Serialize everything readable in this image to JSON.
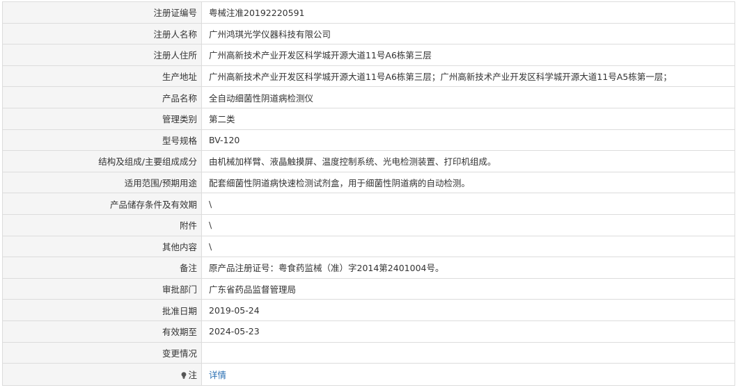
{
  "rows": [
    {
      "label": "注册证编号",
      "value": "粤械注准20192220591"
    },
    {
      "label": "注册人名称",
      "value": "广州鸿琪光学仪器科技有限公司"
    },
    {
      "label": "注册人住所",
      "value": "广州高新技术产业开发区科学城开源大道11号A6栋第三层"
    },
    {
      "label": "生产地址",
      "value": "广州高新技术产业开发区科学城开源大道11号A6栋第三层；广州高新技术产业开发区科学城开源大道11号A5栋第一层；"
    },
    {
      "label": "产品名称",
      "value": "全自动细菌性阴道病检测仪"
    },
    {
      "label": "管理类别",
      "value": "第二类"
    },
    {
      "label": "型号规格",
      "value": "BV-120"
    },
    {
      "label": "结构及组成/主要组成成分",
      "value": "由机械加样臂、液晶触摸屏、温度控制系统、光电检测装置、打印机组成。"
    },
    {
      "label": "适用范围/预期用途",
      "value": "配套细菌性阴道病快速检测试剂盒，用于细菌性阴道病的自动检测。"
    },
    {
      "label": "产品储存条件及有效期",
      "value": "\\"
    },
    {
      "label": "附件",
      "value": "\\"
    },
    {
      "label": "其他内容",
      "value": "\\"
    },
    {
      "label": "备注",
      "value": "原产品注册证号：粤食药监械（准）字2014第2401004号。"
    },
    {
      "label": "审批部门",
      "value": "广东省药品监督管理局"
    },
    {
      "label": "批准日期",
      "value": "2019-05-24"
    },
    {
      "label": "有效期至",
      "value": "2024-05-23"
    },
    {
      "label": "变更情况",
      "value": ""
    }
  ],
  "note": {
    "label": "注",
    "icon": "lightbulb-icon",
    "link": "详情",
    "link_color": "#2a6fb3"
  }
}
